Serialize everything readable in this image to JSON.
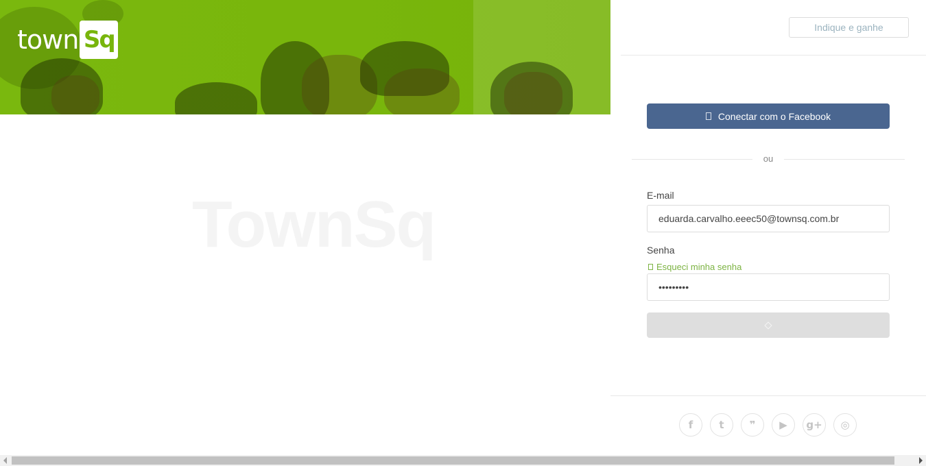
{
  "brand": {
    "logo_word": "town",
    "logo_box": "Sq"
  },
  "background_watermark": {
    "big": "TownSq"
  },
  "header": {
    "refer_button": "Indique e ganhe"
  },
  "login": {
    "facebook_button": "Conectar com o Facebook",
    "divider_text": "ou",
    "email_label": "E-mail",
    "email_value": "eduarda.carvalho.eeec50@townsq.com.br",
    "password_label": "Senha",
    "forgot_link": "Esqueci minha senha",
    "password_value": "•••••••••"
  },
  "social": {
    "items": [
      {
        "icon": "facebook-icon",
        "glyph": "f"
      },
      {
        "icon": "twitter-icon",
        "glyph": "t"
      },
      {
        "icon": "quote-icon",
        "glyph": "❞"
      },
      {
        "icon": "youtube-icon",
        "glyph": "▶"
      },
      {
        "icon": "google-plus-icon",
        "glyph": "g+"
      },
      {
        "icon": "instagram-icon",
        "glyph": "◎"
      }
    ]
  },
  "colors": {
    "brand_green": "#7ab80e",
    "facebook_blue": "#4a6690",
    "link_green": "#7cb342"
  }
}
